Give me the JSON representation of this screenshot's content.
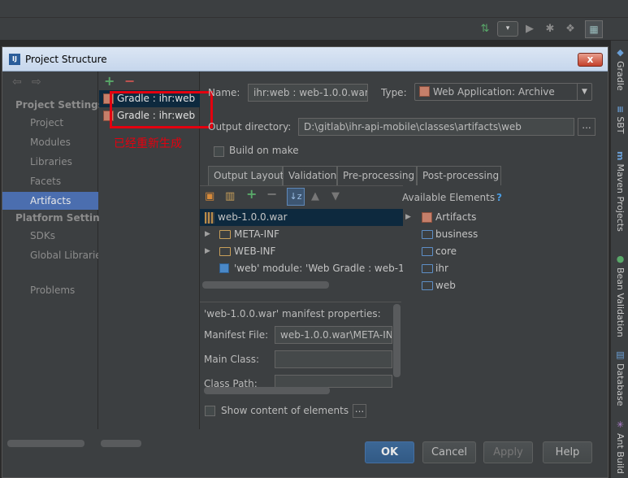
{
  "dialog": {
    "title": "Project Structure",
    "close_label": "x"
  },
  "nav": {
    "project_settings_header": "Project Settings",
    "project_settings": [
      "Project",
      "Modules",
      "Libraries",
      "Facets",
      "Artifacts"
    ],
    "platform_settings_header": "Platform Settings",
    "platform_settings": [
      "SDKs",
      "Global Libraries"
    ],
    "problems": "Problems",
    "selected": "Artifacts"
  },
  "artifacts": {
    "items": [
      "Gradle : ihr:web",
      "Gradle : ihr:web"
    ],
    "annotation": "已经重新生成"
  },
  "form": {
    "name_label": "Name:",
    "name_value": "ihr:web : web-1.0.0.war",
    "type_label": "Type:",
    "type_value": "Web Application: Archive",
    "output_dir_label": "Output directory:",
    "output_dir_value": "D:\\gitlab\\ihr-api-mobile\\classes\\artifacts\\web",
    "build_on_make": "Build on make",
    "dots": "..."
  },
  "tabs": [
    "Output Layout",
    "Validation",
    "Pre-processing",
    "Post-processing"
  ],
  "layout_tree": [
    {
      "label": "web-1.0.0.war"
    },
    {
      "label": "META-INF"
    },
    {
      "label": "WEB-INF"
    },
    {
      "label": "'web' module: 'Web Gradle : web-1."
    }
  ],
  "available": {
    "header": "Available Elements",
    "help": "?",
    "items": [
      "Artifacts",
      "business",
      "core",
      "ihr",
      "web"
    ]
  },
  "manifest": {
    "title": "'web-1.0.0.war' manifest properties:",
    "manifest_file_label": "Manifest File:",
    "manifest_file_value": "web-1.0.0.war\\META-IN",
    "main_class_label": "Main Class:",
    "main_class_value": "",
    "class_path_label": "Class Path:",
    "class_path_value": ""
  },
  "show_content": "Show content of elements",
  "buttons": {
    "ok": "OK",
    "cancel": "Cancel",
    "apply": "Apply",
    "help": "Help"
  },
  "right_tools": [
    "Gradle",
    "SBT",
    "Maven Projects",
    "Bean Validation",
    "Database",
    "Ant Build"
  ],
  "toolbar": {
    "run_config": "▾"
  }
}
